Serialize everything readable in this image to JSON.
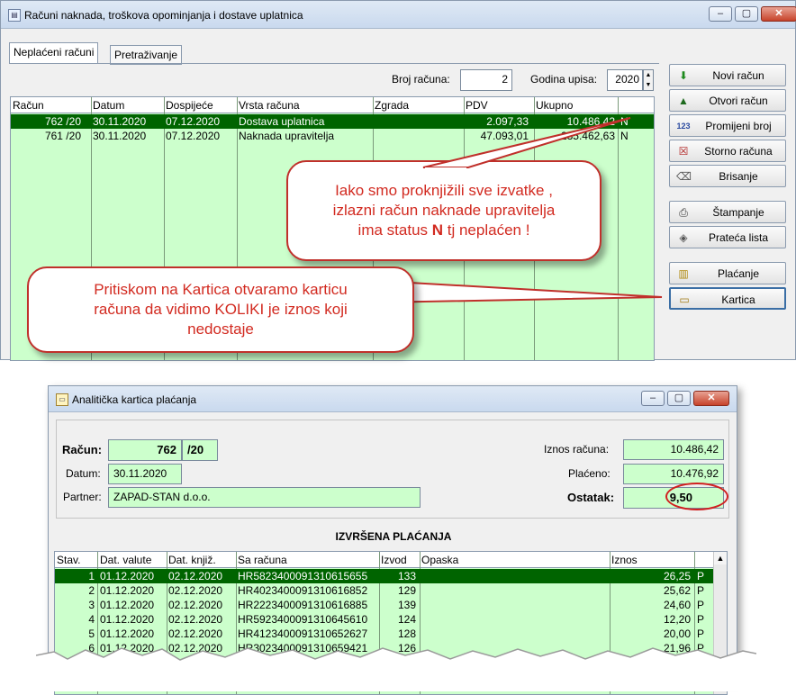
{
  "main_window": {
    "title": "Računi naknada, troškova opominjanja i dostave uplatnica",
    "title_buttons": {
      "minimize": "–",
      "maximize": "▢",
      "close": "✕"
    },
    "tabs": [
      "Neplaćeni računi",
      "Pretraživanje"
    ],
    "filters": {
      "invoice_number_label": "Broj računa:",
      "invoice_number_value": "2",
      "year_label": "Godina upisa:",
      "year_value": "2020"
    },
    "table": {
      "columns": [
        "Račun",
        "Datum",
        "Dospijeće",
        "Vrsta računa",
        "Zgrada",
        "PDV",
        "Ukupno",
        ""
      ],
      "rows": [
        {
          "racun": "762 /20",
          "datum": "30.11.2020",
          "dospijece": "07.12.2020",
          "vrsta": "Dostava uplatnica",
          "zgrada": "",
          "pdv": "2.097,33",
          "ukupno": "10.486,42",
          "status": "N"
        },
        {
          "racun": "761 /20",
          "datum": "30.11.2020",
          "dospijece": "07.12.2020",
          "vrsta": "Naknada upravitelja",
          "zgrada": "",
          "pdv": "47.093,01",
          "ukupno": "235.462,63",
          "status": "N"
        }
      ]
    },
    "buttons": [
      {
        "label": "Novi račun",
        "icon": "plus-arrow-icon"
      },
      {
        "label": "Otvori račun",
        "icon": "triangle-icon"
      },
      {
        "label": "Promijeni broj",
        "icon": "123-icon"
      },
      {
        "label": "Storno računa",
        "icon": "x-box-icon"
      },
      {
        "label": "Brisanje",
        "icon": "eraser-icon"
      },
      {
        "label": "Štampanje",
        "icon": "printer-icon"
      },
      {
        "label": "Prateća lista",
        "icon": "diamond-icon"
      },
      {
        "label": "Plaćanje",
        "icon": "coins-icon"
      },
      {
        "label": "Kartica",
        "icon": "card-icon"
      }
    ]
  },
  "callouts": {
    "status_note": {
      "line1": "Iako smo proknjižili sve izvatke ,",
      "line2": "izlazni račun naknade upravitelja",
      "line3_pre": "ima status ",
      "line3_bold": "N",
      "line3_post": " tj neplaćen !"
    },
    "kartica_note": {
      "line1": "Pritiskom na Kartica otvaramo karticu",
      "line2": "računa da vidimo KOLIKI je iznos koji",
      "line3": "nedostaje"
    }
  },
  "card_window": {
    "title": "Analitička kartica plaćanja",
    "title_buttons": {
      "minimize": "–",
      "maximize": "▢",
      "close": "✕"
    },
    "racun_label": "Račun:",
    "racun_number": "762",
    "racun_suffix": "/20",
    "datum_label": "Datum:",
    "datum_value": "30.11.2020",
    "partner_label": "Partner:",
    "partner_value": "ZAPAD-STAN d.o.o.",
    "iznos_label": "Iznos računa:",
    "iznos_value": "10.486,42",
    "placeno_label": "Plaćeno:",
    "placeno_value": "10.476,92",
    "ostatak_label": "Ostatak:",
    "ostatak_value": "9,50",
    "section_title": "IZVRŠENA PLAĆANJA",
    "table": {
      "columns": [
        "Stav.",
        "Dat. valute",
        "Dat. knjiž.",
        "Sa računa",
        "Izvod",
        "Opaska",
        "Iznos",
        ""
      ],
      "rows": [
        {
          "stav": "1",
          "valuta": "01.12.2020",
          "knjiz": "02.12.2020",
          "racun": "HR5823400091310615655",
          "izvod": "133",
          "opaska": "",
          "iznos": "26,25",
          "p": "P"
        },
        {
          "stav": "2",
          "valuta": "01.12.2020",
          "knjiz": "02.12.2020",
          "racun": "HR4023400091310616852",
          "izvod": "129",
          "opaska": "",
          "iznos": "25,62",
          "p": "P"
        },
        {
          "stav": "3",
          "valuta": "01.12.2020",
          "knjiz": "02.12.2020",
          "racun": "HR2223400091310616885",
          "izvod": "139",
          "opaska": "",
          "iznos": "24,60",
          "p": "P"
        },
        {
          "stav": "4",
          "valuta": "01.12.2020",
          "knjiz": "02.12.2020",
          "racun": "HR5923400091310645610",
          "izvod": "124",
          "opaska": "",
          "iznos": "12,20",
          "p": "P"
        },
        {
          "stav": "5",
          "valuta": "01.12.2020",
          "knjiz": "02.12.2020",
          "racun": "HR4123400091310652627",
          "izvod": "128",
          "opaska": "",
          "iznos": "20,00",
          "p": "P"
        },
        {
          "stav": "6",
          "valuta": "01.12.2020",
          "knjiz": "02.12.2020",
          "racun": "HR3023400091310659421",
          "izvod": "126",
          "opaska": "",
          "iznos": "21,96",
          "p": "P"
        }
      ]
    }
  },
  "colors": {
    "grid_bg": "#ccffcc",
    "selected_row": "#006400",
    "callout_red": "#d22a20"
  }
}
